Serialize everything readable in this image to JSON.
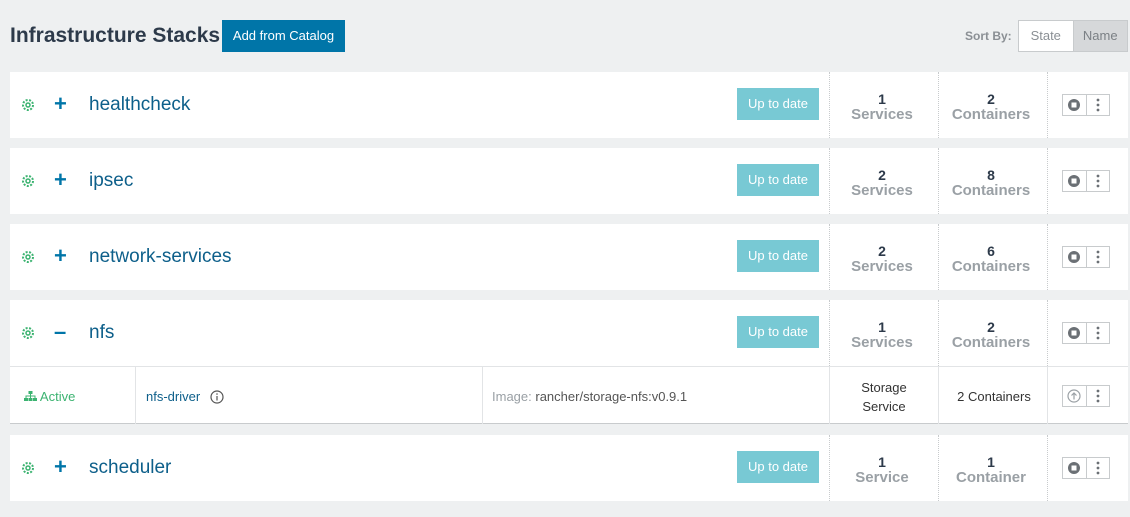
{
  "header": {
    "title": "Infrastructure Stacks",
    "add_button": "Add from Catalog",
    "sort_label": "Sort By:",
    "sort_options": [
      "State",
      "Name"
    ],
    "sort_selected": "Name"
  },
  "stacks": [
    {
      "name": "healthcheck",
      "toggle": "+",
      "status": "Up to date",
      "services_count": "1",
      "services_label": "Services",
      "containers_count": "2",
      "containers_label": "Containers"
    },
    {
      "name": "ipsec",
      "toggle": "+",
      "status": "Up to date",
      "services_count": "2",
      "services_label": "Services",
      "containers_count": "8",
      "containers_label": "Containers"
    },
    {
      "name": "network-services",
      "toggle": "+",
      "status": "Up to date",
      "services_count": "2",
      "services_label": "Services",
      "containers_count": "6",
      "containers_label": "Containers"
    },
    {
      "name": "nfs",
      "toggle": "–",
      "status": "Up to date",
      "services_count": "1",
      "services_label": "Services",
      "containers_count": "2",
      "containers_label": "Containers",
      "service": {
        "state": "Active",
        "name": "nfs-driver",
        "image_label": "Image:",
        "image": "rancher/storage-nfs:v0.9.1",
        "type_line1": "Storage",
        "type_line2": "Service",
        "containers": "2 Containers"
      }
    },
    {
      "name": "scheduler",
      "toggle": "+",
      "status": "Up to date",
      "services_count": "1",
      "services_label": "Service",
      "containers_count": "1",
      "containers_label": "Container"
    }
  ],
  "colors": {
    "primary": "#0075a8",
    "status": "#78c9d4",
    "active": "#3cb371"
  }
}
